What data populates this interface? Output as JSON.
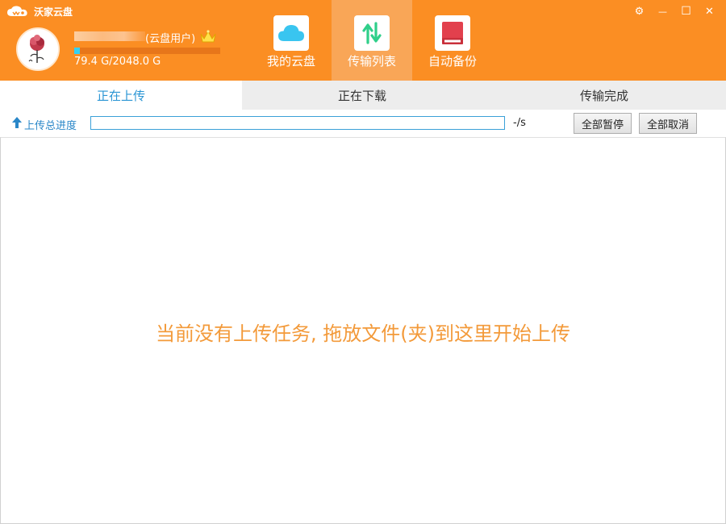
{
  "app": {
    "title": "沃家云盘"
  },
  "window_controls": {
    "settings": "⚙",
    "minimize": "—",
    "maximize": "☐",
    "close": "✕"
  },
  "user": {
    "type_label": "(云盘用户)",
    "quota_text": "79.4 G/2048.0 G",
    "quota_used_fraction": 0.039
  },
  "nav": {
    "items": [
      {
        "label": "我的云盘",
        "icon": "cloud-icon"
      },
      {
        "label": "传输列表",
        "icon": "transfer-icon"
      },
      {
        "label": "自动备份",
        "icon": "backup-drive-icon"
      }
    ],
    "active_index": 1
  },
  "tabs": [
    {
      "label": "正在上传"
    },
    {
      "label": "正在下载"
    },
    {
      "label": "传输完成"
    }
  ],
  "toolbar": {
    "progress_label": "上传总进度",
    "progress_fraction": 0,
    "speed": "-/s",
    "pause_all": "全部暂停",
    "cancel_all": "全部取消"
  },
  "content": {
    "empty_message": "当前没有上传任务, 拖放文件(夹)到这里开始上传"
  },
  "colors": {
    "header": "#fb8e23",
    "accent_blue": "#2a95d4",
    "message_orange": "#f39a3a"
  }
}
